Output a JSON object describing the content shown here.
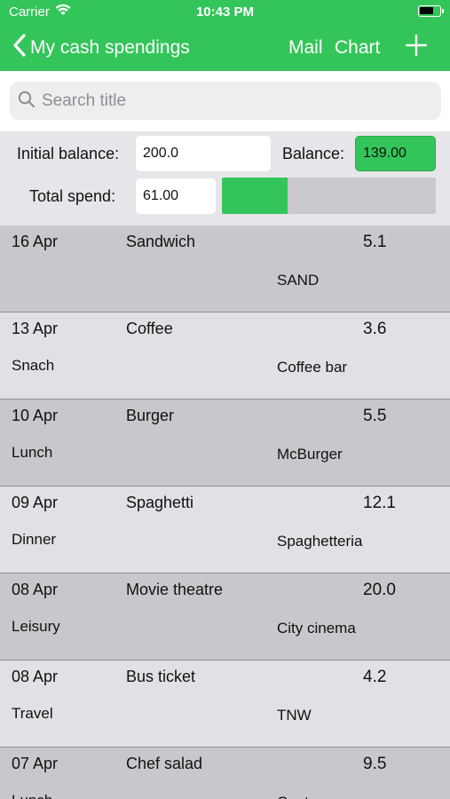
{
  "status_bar": {
    "carrier": "Carrier",
    "time": "10:43 PM"
  },
  "nav": {
    "back_label": "My cash spendings",
    "mail_label": "Mail",
    "chart_label": "Chart",
    "add_icon": "plus-icon"
  },
  "search": {
    "placeholder": "Search title",
    "value": ""
  },
  "summary": {
    "initial_balance_label": "Initial balance:",
    "initial_balance_value": "200.0",
    "balance_label": "Balance:",
    "balance_value": "139.00",
    "total_spend_label": "Total spend:",
    "total_spend_value": "61.00",
    "spend_progress_fraction": 0.305
  },
  "colors": {
    "accent": "#34c55a"
  },
  "entries": [
    {
      "date": "16 Apr",
      "title": "Sandwich",
      "amount": "5.1",
      "category": "",
      "place": "SAND"
    },
    {
      "date": "13 Apr",
      "title": "Coffee",
      "amount": "3.6",
      "category": "Snach",
      "place": "Coffee bar"
    },
    {
      "date": "10 Apr",
      "title": "Burger",
      "amount": "5.5",
      "category": "Lunch",
      "place": "McBurger"
    },
    {
      "date": "09 Apr",
      "title": "Spaghetti",
      "amount": "12.1",
      "category": "Dinner",
      "place": "Spaghetteria"
    },
    {
      "date": "08 Apr",
      "title": "Movie theatre",
      "amount": "20.0",
      "category": "Leisury",
      "place": "City cinema"
    },
    {
      "date": "08 Apr",
      "title": "Bus ticket",
      "amount": "4.2",
      "category": "Travel",
      "place": "TNW"
    },
    {
      "date": "07 Apr",
      "title": "Chef salad",
      "amount": "9.5",
      "category": "Lunch",
      "place": "Canteen"
    }
  ]
}
